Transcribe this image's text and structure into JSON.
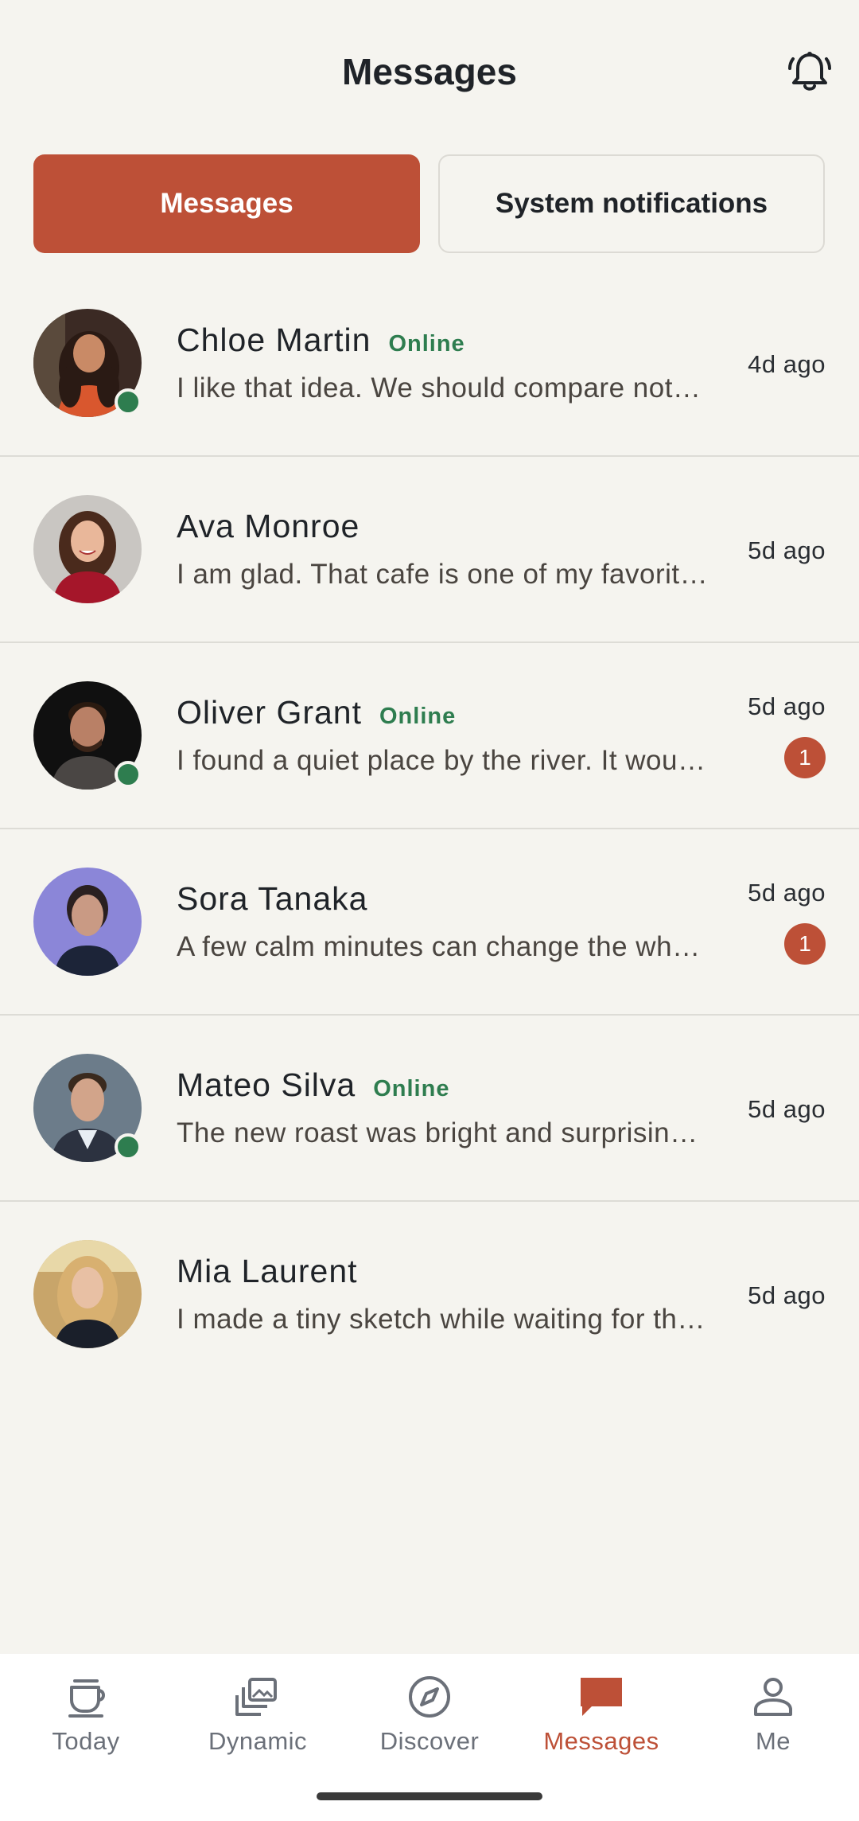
{
  "header": {
    "title": "Messages",
    "bell_icon": "bell-ring-icon"
  },
  "tabs": [
    {
      "label": "Messages",
      "active": true
    },
    {
      "label": "System notifications",
      "active": false
    }
  ],
  "conversations": [
    {
      "name": "Chloe Martin",
      "online": true,
      "online_label": "Online",
      "preview": "I like that idea. We should compare notes sometime soon.",
      "time": "4d ago",
      "unread": null
    },
    {
      "name": "Ava Monroe",
      "online": false,
      "online_label": "",
      "preview": "I am glad. That cafe is one of my favorite places.",
      "time": "5d ago",
      "unread": null
    },
    {
      "name": "Oliver Grant",
      "online": true,
      "online_label": "Online",
      "preview": "I found a quiet place by the river. It would be nice.",
      "time": "5d ago",
      "unread": "1"
    },
    {
      "name": "Sora Tanaka",
      "online": false,
      "online_label": "",
      "preview": "A few calm minutes can change the whole day.",
      "time": "5d ago",
      "unread": "1"
    },
    {
      "name": "Mateo Silva",
      "online": true,
      "online_label": "Online",
      "preview": "The new roast was bright and surprisingly smooth.",
      "time": "5d ago",
      "unread": null
    },
    {
      "name": "Mia Laurent",
      "online": false,
      "online_label": "",
      "preview": "I made a tiny sketch while waiting for the train.",
      "time": "5d ago",
      "unread": null
    }
  ],
  "bottom_nav": [
    {
      "label": "Today",
      "icon": "cup-icon",
      "active": false
    },
    {
      "label": "Dynamic",
      "icon": "stacked-photos-icon",
      "active": false
    },
    {
      "label": "Discover",
      "icon": "compass-icon",
      "active": false
    },
    {
      "label": "Messages",
      "icon": "chat-bubble-icon",
      "active": true
    },
    {
      "label": "Me",
      "icon": "person-icon",
      "active": false
    }
  ],
  "colors": {
    "accent": "#bd5037",
    "online": "#2e7d4f",
    "background": "#f5f4ef"
  }
}
